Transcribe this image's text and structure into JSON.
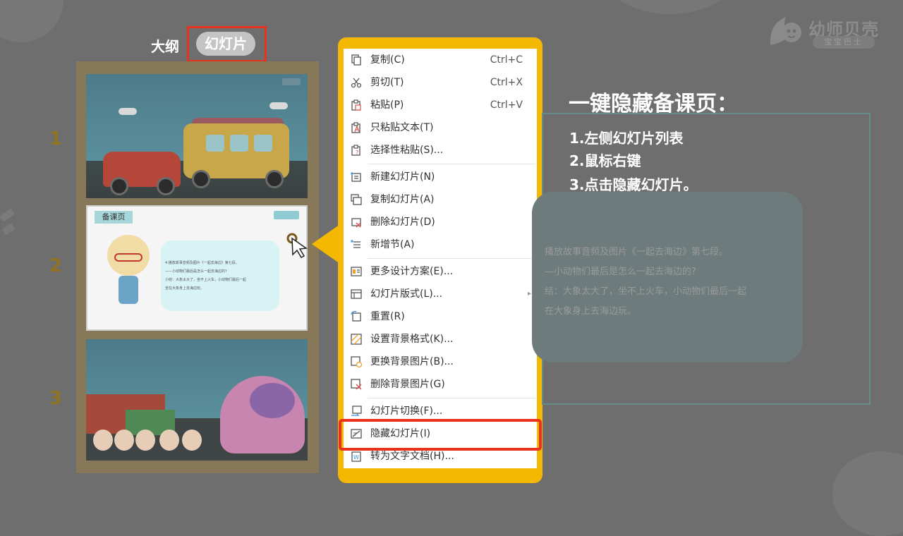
{
  "logo": {
    "name": "幼师贝壳",
    "tagline": "宝宝巴士"
  },
  "view_tabs": {
    "outline": "大纲",
    "slides": "幻灯片"
  },
  "slides": [
    {
      "number": "1"
    },
    {
      "number": "2",
      "badge": "备课页",
      "lines": [
        "4.播放故事音频及图片《一起去海边》第七段。",
        "——小动物们最后是怎么一起去海边的？",
        "小结：大象太大了，坐不上火车，小动物们最后一起",
        "坐在大象身上去海边玩。"
      ]
    },
    {
      "number": "3"
    }
  ],
  "context_menu": {
    "items": [
      {
        "label": "复制(C)",
        "shortcut": "Ctrl+C",
        "icon": "copy-icon"
      },
      {
        "label": "剪切(T)",
        "shortcut": "Ctrl+X",
        "icon": "scissors-icon"
      },
      {
        "label": "粘贴(P)",
        "shortcut": "Ctrl+V",
        "icon": "paste-icon"
      },
      {
        "label": "只粘贴文本(T)",
        "icon": "paste-text-icon"
      },
      {
        "label": "选择性粘贴(S)...",
        "icon": "paste-special-icon"
      },
      {
        "label": "新建幻灯片(N)",
        "icon": "new-slide-icon"
      },
      {
        "label": "复制幻灯片(A)",
        "icon": "duplicate-slide-icon"
      },
      {
        "label": "删除幻灯片(D)",
        "icon": "delete-slide-icon"
      },
      {
        "label": "新增节(A)",
        "icon": "add-section-icon"
      },
      {
        "label": "更多设计方案(E)...",
        "icon": "design-icon"
      },
      {
        "label": "幻灯片版式(L)...",
        "icon": "layout-icon",
        "submenu": "▸"
      },
      {
        "label": "重置(R)",
        "icon": "reset-icon"
      },
      {
        "label": "设置背景格式(K)...",
        "icon": "background-format-icon"
      },
      {
        "label": "更换背景图片(B)...",
        "icon": "change-background-icon"
      },
      {
        "label": "删除背景图片(G)",
        "icon": "delete-background-icon"
      },
      {
        "label": "幻灯片切换(F)...",
        "icon": "transition-icon"
      },
      {
        "label": "隐藏幻灯片(I)",
        "icon": "hide-slide-icon"
      },
      {
        "label": "转为文字文档(H)...",
        "icon": "convert-doc-icon"
      }
    ]
  },
  "instructions": {
    "title": "一键隐藏备课页：",
    "steps": [
      "1.左侧幻灯片列表",
      "2.鼠标右键",
      "3.点击隐藏幻灯片。"
    ]
  },
  "background_slide_text": [
    "播放故事音频及图片《一起去海边》第七段。",
    "—小动物们最后是怎么一起去海边的?",
    "结：大象太大了，坐不上火车，小动物们最后一起",
    "在大象身上去海边玩。"
  ],
  "colors": {
    "highlight_red": "#e8321e",
    "menu_frame": "#f5b800",
    "overlay": "#6e6e6e"
  }
}
